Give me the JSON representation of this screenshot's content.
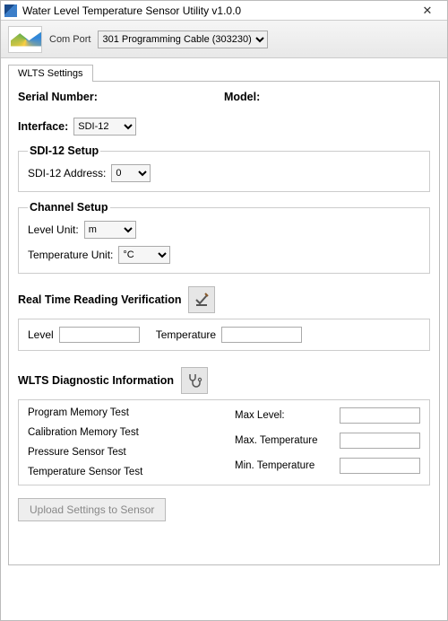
{
  "window": {
    "title": "Water Level Temperature Sensor Utility v1.0.0",
    "close_glyph": "✕"
  },
  "toolbar": {
    "com_port_label": "Com Port",
    "com_port_selected": "301 Programming Cable (303230)"
  },
  "tabs": {
    "settings_label": "WLTS Settings"
  },
  "device": {
    "serial_label": "Serial Number:",
    "serial_value": "",
    "model_label": "Model:",
    "model_value": ""
  },
  "interface": {
    "label": "Interface:",
    "selected": "SDI-12"
  },
  "sdi12": {
    "legend": "SDI-12 Setup",
    "address_label": "SDI-12 Address:",
    "address_selected": "0"
  },
  "channel": {
    "legend": "Channel Setup",
    "level_unit_label": "Level Unit:",
    "level_unit_selected": "m",
    "temp_unit_label": "Temperature Unit:",
    "temp_unit_selected": "°C"
  },
  "realtime": {
    "heading": "Real Time Reading Verification",
    "level_label": "Level",
    "level_value": "",
    "temp_label": "Temperature",
    "temp_value": ""
  },
  "diag": {
    "heading": "WLTS Diagnostic Information",
    "tests": {
      "program_mem": "Program Memory Test",
      "calib_mem": "Calibration Memory Test",
      "pressure": "Pressure Sensor Test",
      "temp": "Temperature Sensor Test"
    },
    "max_level_label": "Max Level:",
    "max_level_value": "",
    "max_temp_label": "Max. Temperature",
    "max_temp_value": "",
    "min_temp_label": "Min. Temperature",
    "min_temp_value": ""
  },
  "upload": {
    "label": "Upload Settings to Sensor"
  }
}
